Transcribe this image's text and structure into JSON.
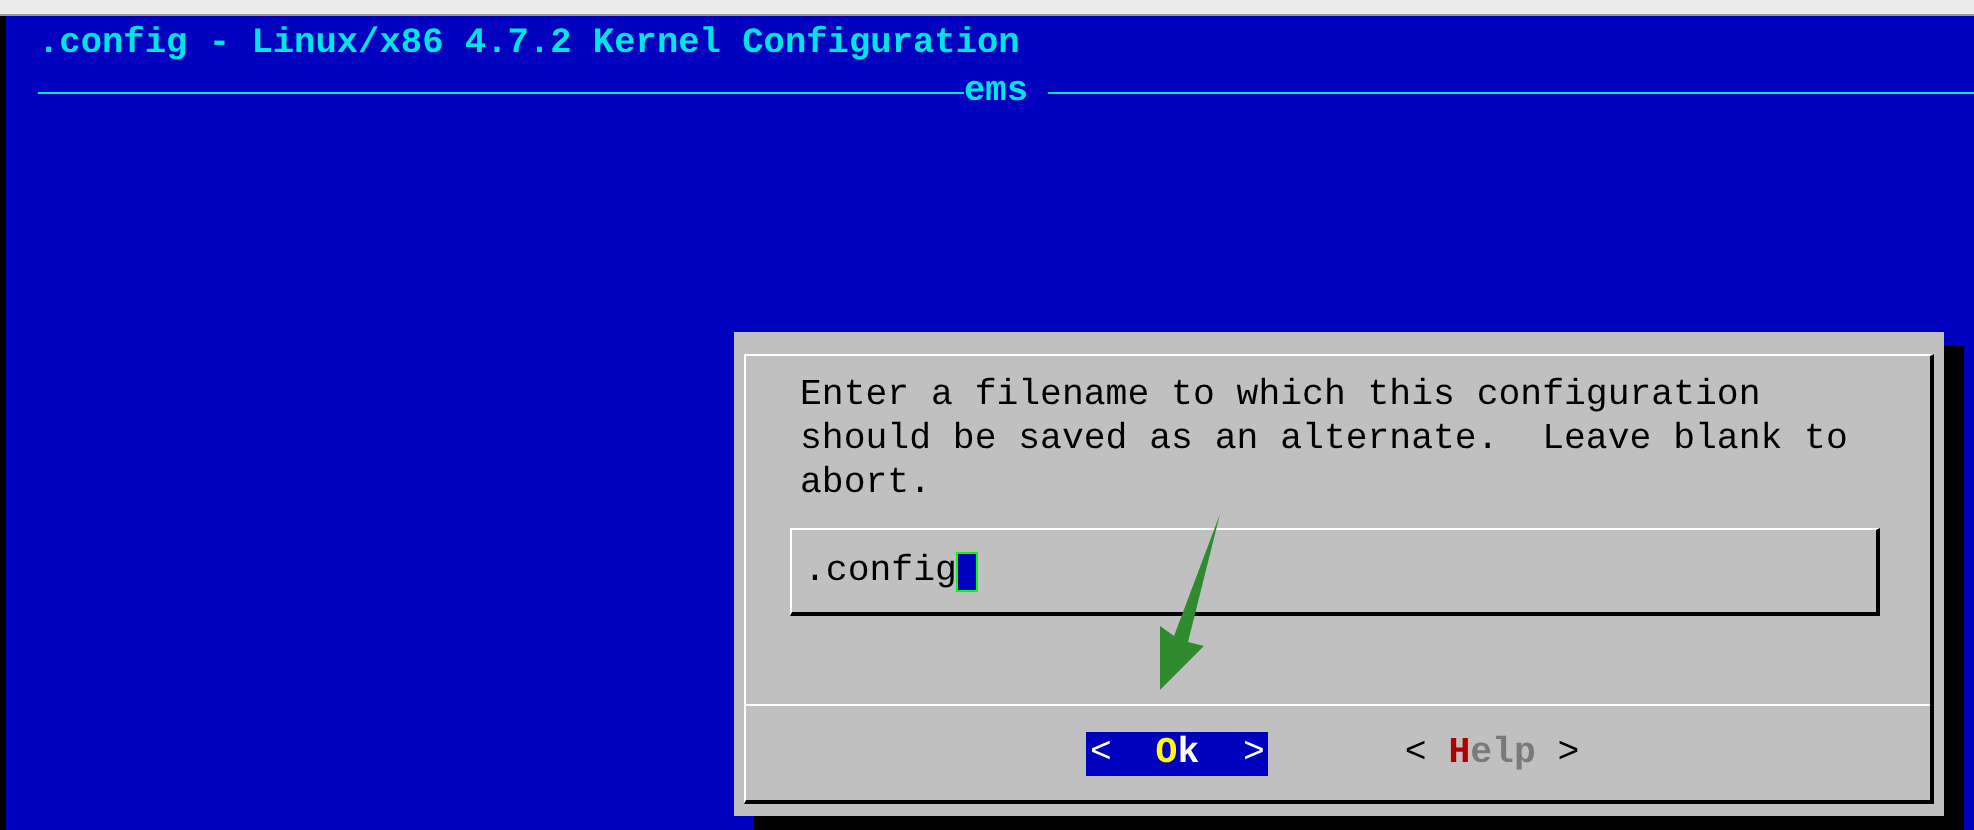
{
  "window": {
    "title": ".config - Linux/x86 4.7.2 Kernel Configuration",
    "subtitle": "ems"
  },
  "dialog": {
    "message": "Enter a filename to which this configuration should be saved as an alternate.  Leave blank to abort.",
    "input": {
      "value": ".config"
    },
    "buttons": [
      {
        "left": "<",
        "hotkey": "O",
        "rest": "k",
        "right": ">",
        "selected": true
      },
      {
        "left": "<",
        "hotkey": "H",
        "rest": "elp",
        "right": ">",
        "selected": false
      }
    ]
  }
}
